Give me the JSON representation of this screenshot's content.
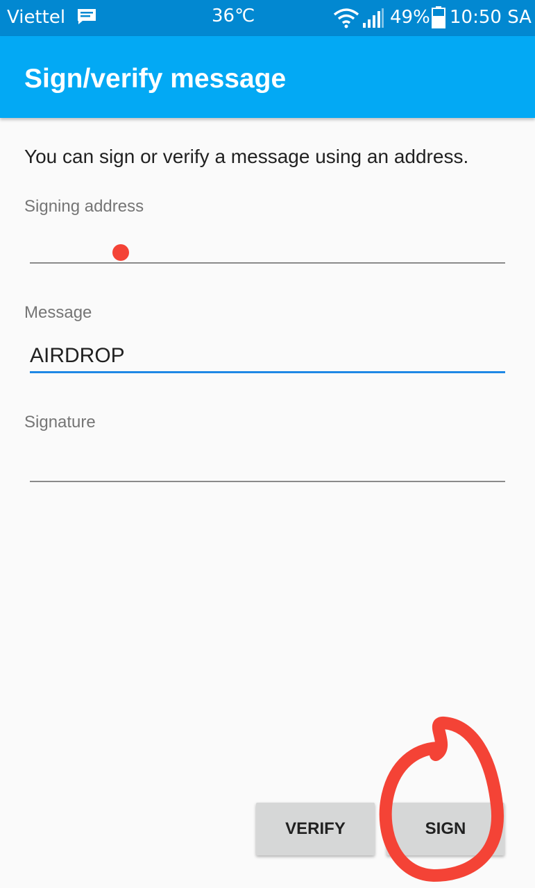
{
  "status_bar": {
    "carrier": "Viettel",
    "temperature": "36℃",
    "battery": "49%",
    "time": "10:50 SA"
  },
  "app_bar": {
    "title": "Sign/verify message"
  },
  "intro": "You can sign or verify a message using an address.",
  "fields": {
    "signing_address": {
      "label": "Signing address",
      "value": ""
    },
    "message": {
      "label": "Message",
      "value": "AIRDROP"
    },
    "signature": {
      "label": "Signature",
      "value": ""
    }
  },
  "buttons": {
    "verify": "VERIFY",
    "sign": "SIGN"
  },
  "colors": {
    "status_bar": "#0288d1",
    "app_bar": "#03a9f4",
    "focus_underline": "#1e88e5",
    "annotation": "#f44336"
  }
}
